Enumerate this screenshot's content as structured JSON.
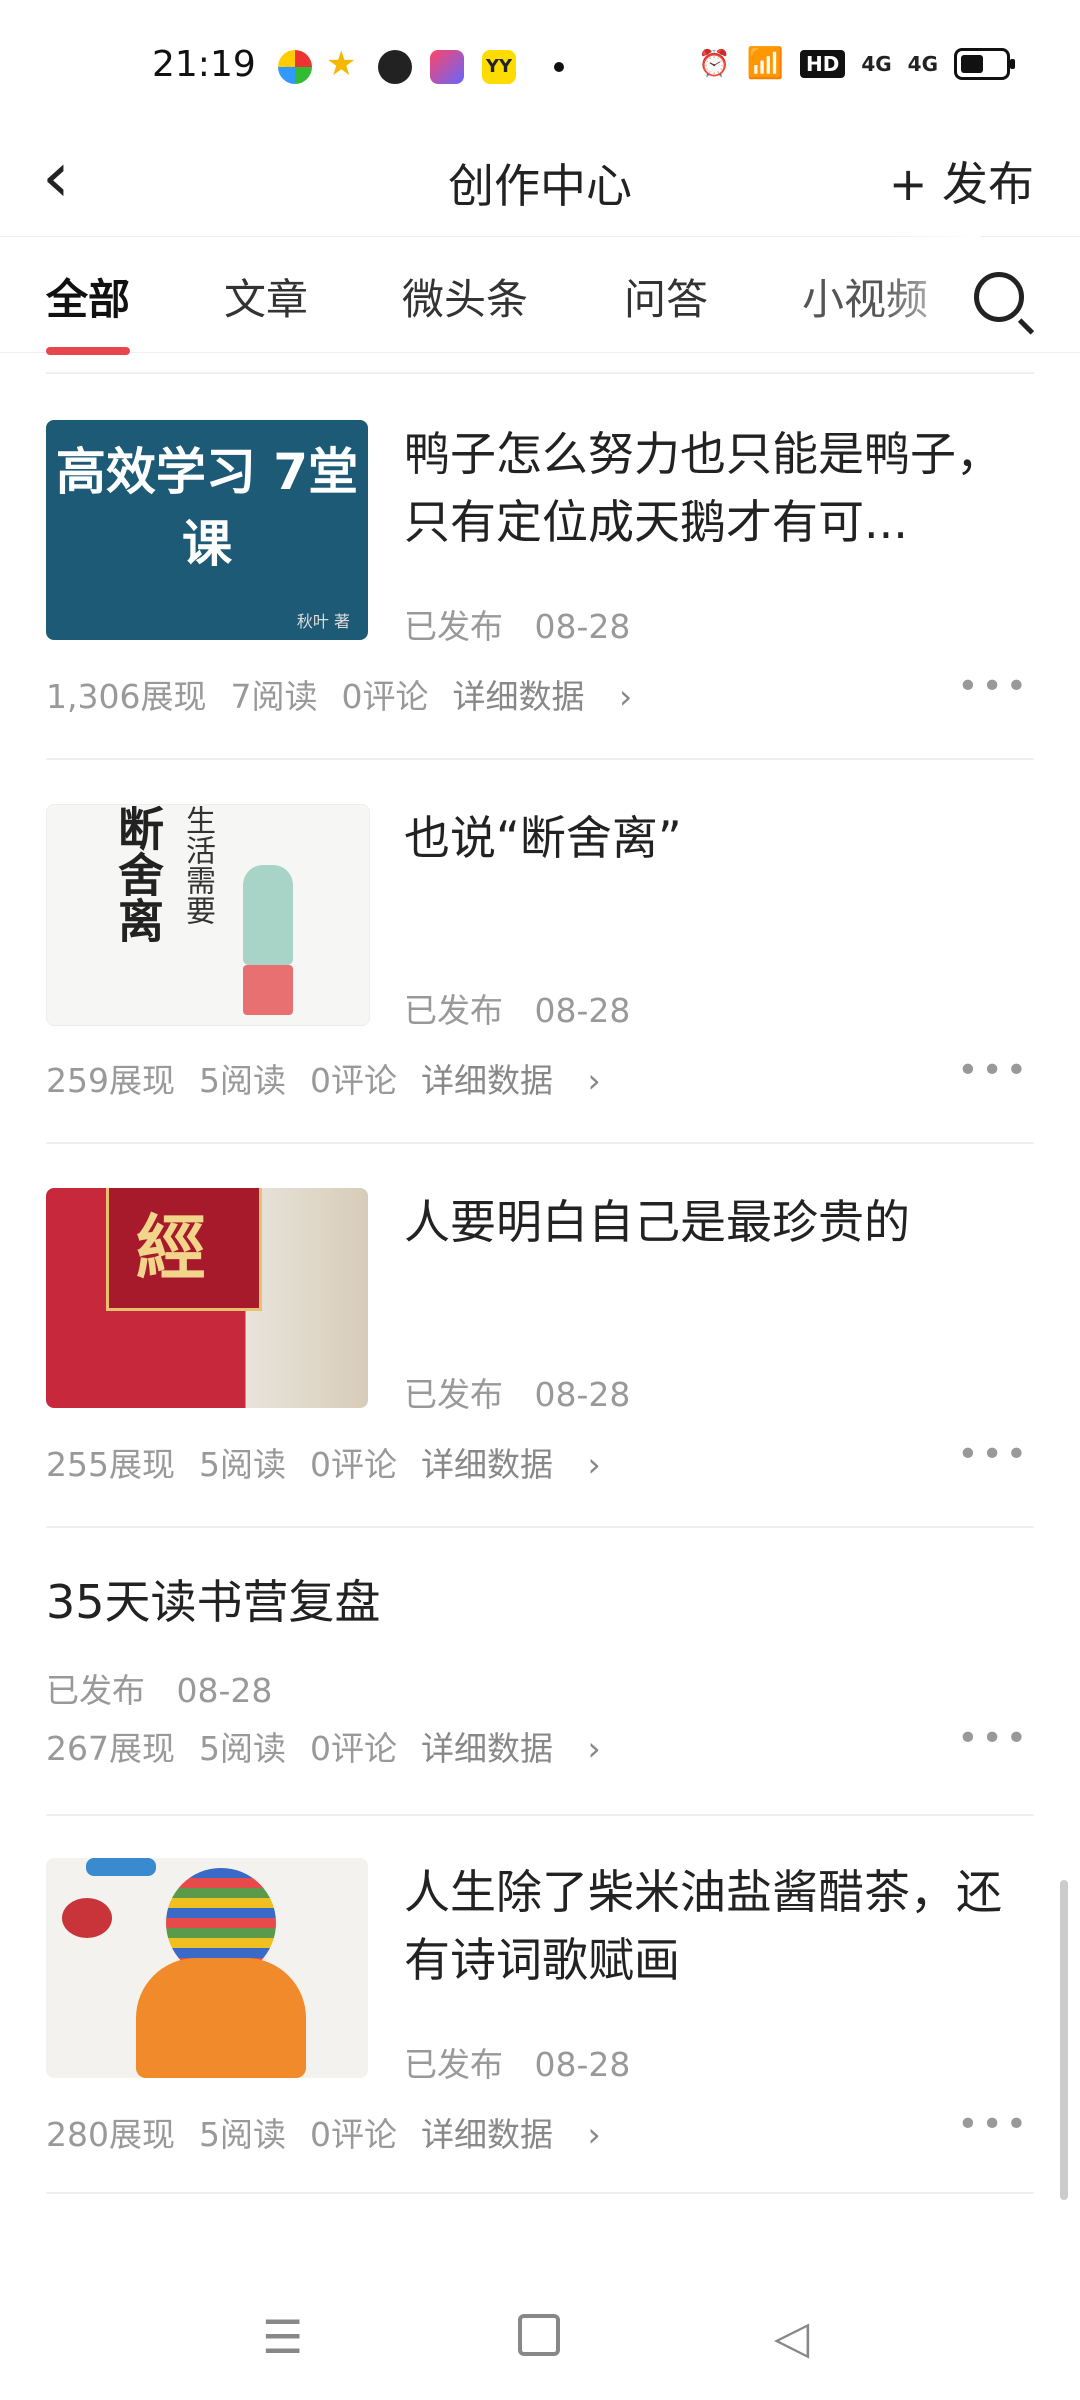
{
  "status_bar": {
    "time": "21:19",
    "icons_right": [
      "alarm-icon",
      "wifi-icon",
      "hd-icon",
      "signal-4g-icon",
      "signal-4g-icon",
      "battery-icon"
    ],
    "hd_label": "HD",
    "net_label_1": "4G",
    "net_label_2": "4G"
  },
  "header": {
    "title": "创作中心",
    "publish_label": "+ 发布"
  },
  "tabs": [
    {
      "label": "全部",
      "active": true
    },
    {
      "label": "文章",
      "active": false
    },
    {
      "label": "微头条",
      "active": false
    },
    {
      "label": "问答",
      "active": false
    },
    {
      "label": "小视频",
      "active": false
    }
  ],
  "articles": [
    {
      "title": "鸭子怎么努力也只能是鸭子，只有定位成天鹅才有可...",
      "status": "已发布",
      "date": "08-28",
      "views": "1,306展现",
      "reads": "7阅读",
      "comments": "0评论",
      "detail": "详细数据",
      "thumb_text": "高效学习 7堂课",
      "thumb_author": "秋叶 著"
    },
    {
      "title": "也说“断舍离”",
      "status": "已发布",
      "date": "08-28",
      "views": "259展现",
      "reads": "5阅读",
      "comments": "0评论",
      "detail": "详细数据",
      "thumb_text": "断舍离",
      "thumb_sub": "生活需要"
    },
    {
      "title": "人要明白自己是最珍贵的",
      "status": "已发布",
      "date": "08-28",
      "views": "255展现",
      "reads": "5阅读",
      "comments": "0评论",
      "detail": "详细数据",
      "thumb_text": "經"
    },
    {
      "title": "35天读书营复盘",
      "status": "已发布",
      "date": "08-28",
      "views": "267展现",
      "reads": "5阅读",
      "comments": "0评论",
      "detail": "详细数据"
    },
    {
      "title": "人生除了柴米油盐酱醋茶，还有诗词歌赋画",
      "status": "已发布",
      "date": "08-28",
      "views": "280展现",
      "reads": "5阅读",
      "comments": "0评论",
      "detail": "详细数据"
    }
  ],
  "colors": {
    "accent": "#e8464e",
    "muted_text": "#999999",
    "thumb1_bg": "#1d5a76",
    "thumb3_bg": "#c8283c"
  }
}
